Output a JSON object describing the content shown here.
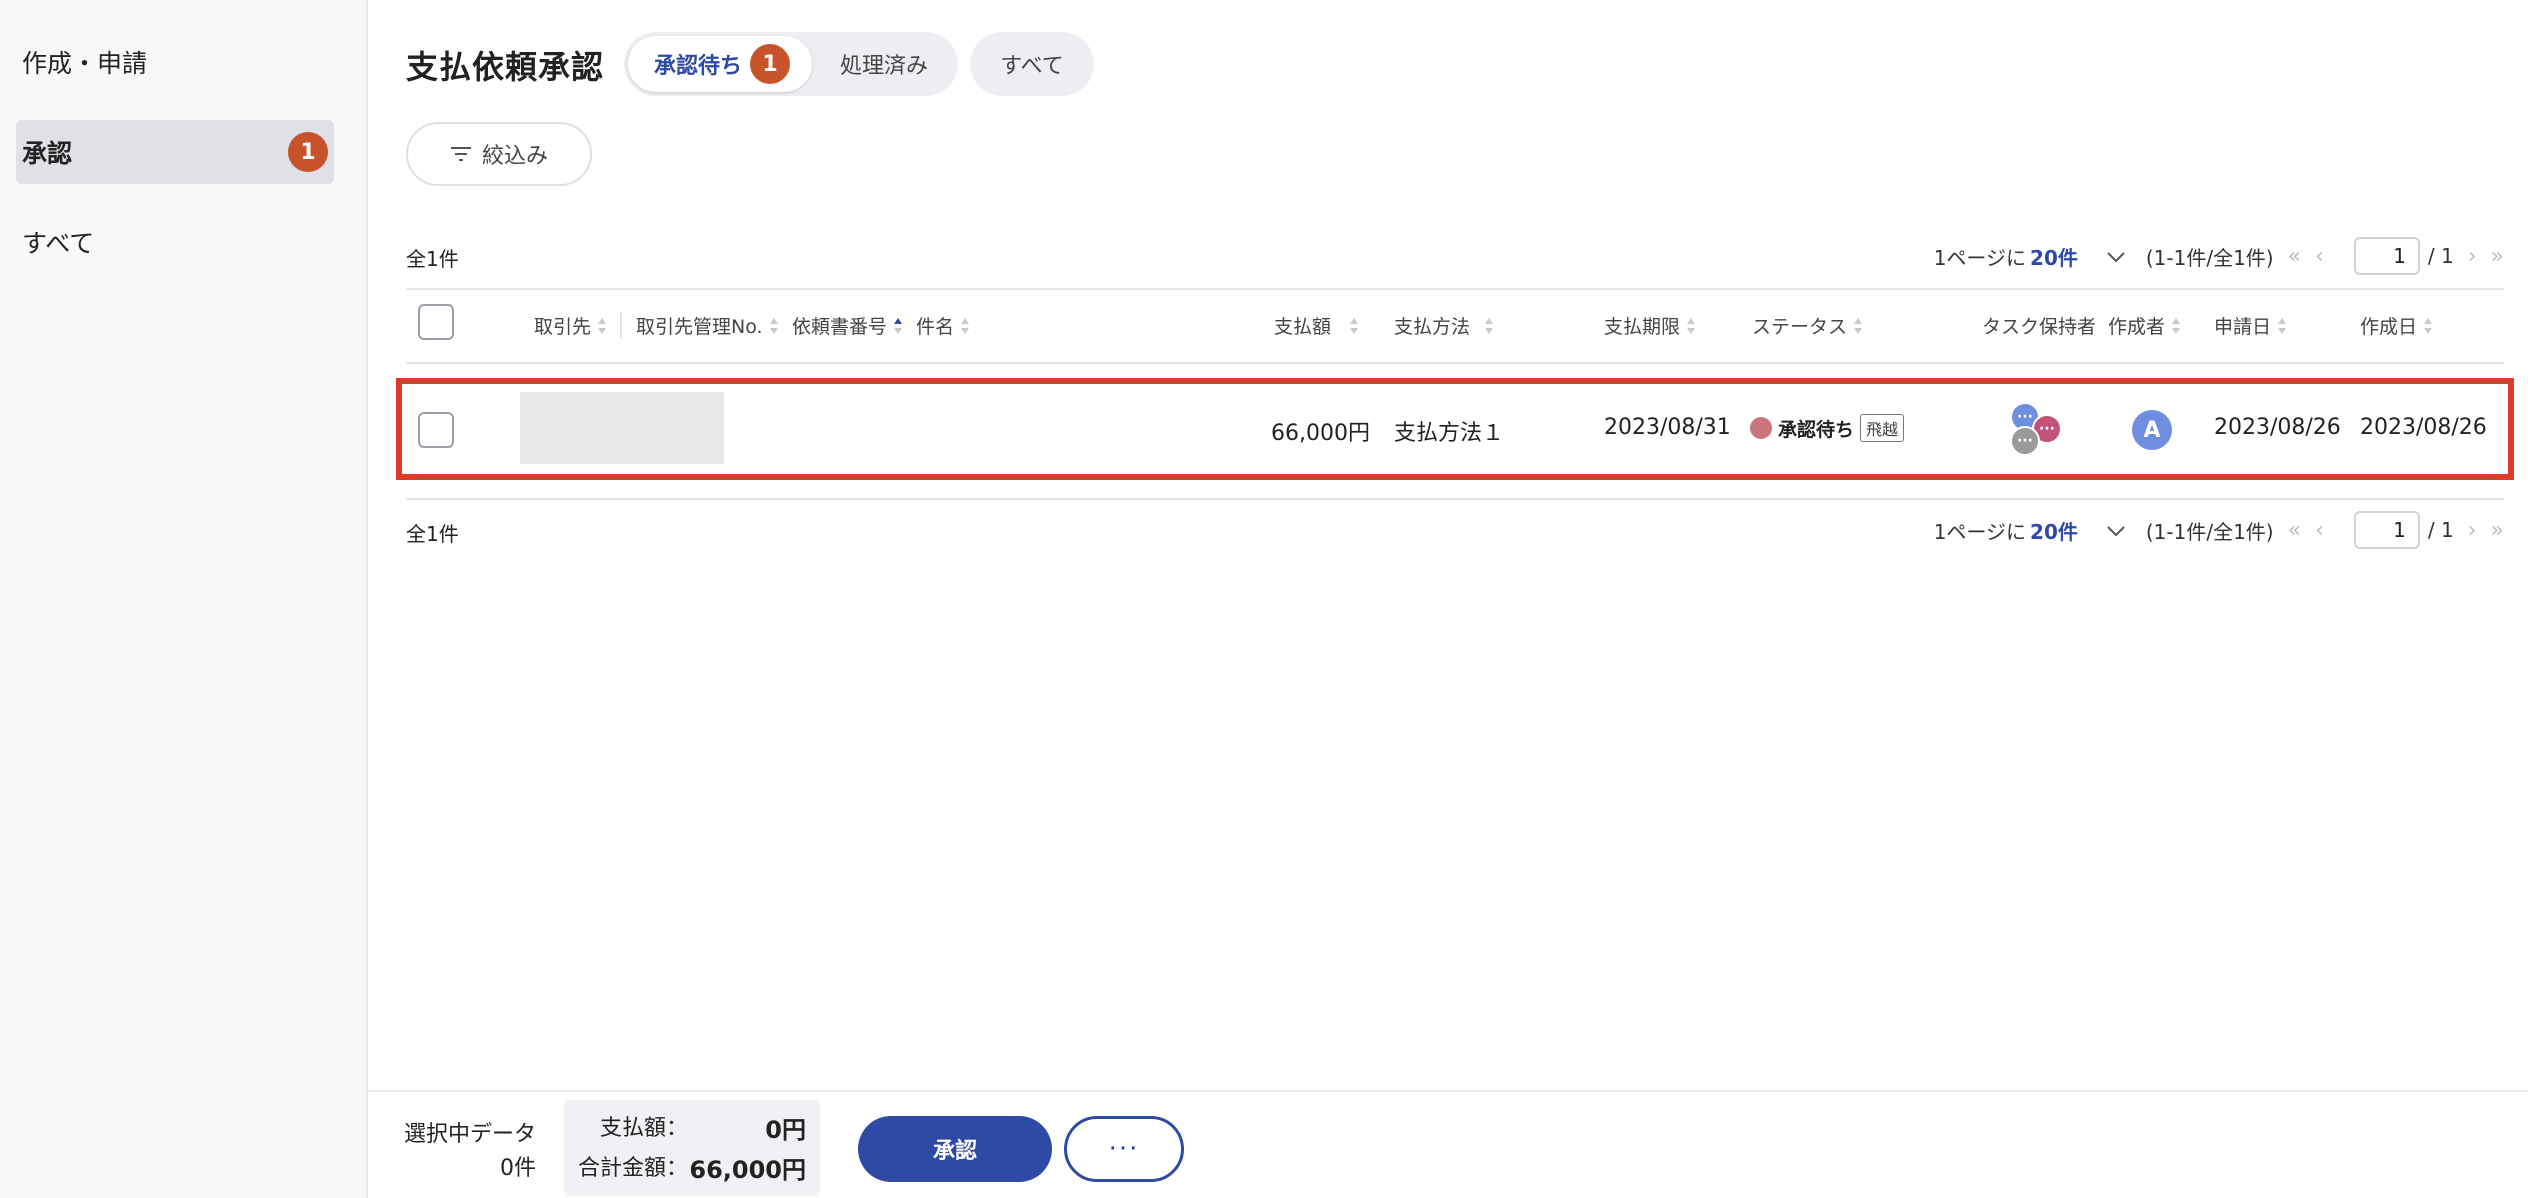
{
  "sidebar": {
    "items": [
      {
        "label": "作成・申請"
      },
      {
        "label": "承認",
        "badge": "1"
      },
      {
        "label": "すべて"
      }
    ]
  },
  "header": {
    "title": "支払依頼承認",
    "tabs": [
      {
        "label": "承認待ち",
        "badge": "1"
      },
      {
        "label": "処理済み"
      }
    ],
    "all_label": "すべて",
    "filter_label": "絞込み"
  },
  "list": {
    "total_label": "全1件",
    "pager": {
      "per_page_prefix": "1ページに",
      "per_page_value": "20件",
      "range": "(1-1件/全1件)",
      "current_page": "1",
      "total_pages": "/ 1"
    },
    "columns": {
      "partner": "取引先",
      "partner_no": "取引先管理No.",
      "request_no": "依頼書番号",
      "subject": "件名",
      "amount": "支払額",
      "method": "支払方法",
      "due": "支払期限",
      "status": "ステータス",
      "holder": "タスク保持者",
      "creator": "作成者",
      "apply_date": "申請日",
      "created_date": "作成日"
    },
    "rows": [
      {
        "amount": "66,000円",
        "method": "支払方法１",
        "due": "2023/08/31",
        "status": "承認待ち",
        "status_tag": "飛越",
        "creator_initial": "A",
        "apply_date": "2023/08/26",
        "created_date": "2023/08/26"
      }
    ]
  },
  "footer": {
    "selected_label": "選択中データ",
    "selected_count": "0件",
    "pay_amount_label": "支払額：",
    "pay_amount_value": "0円",
    "total_label": "合計金額：",
    "total_value": "66,000円",
    "approve_label": "承認",
    "more_label": "···"
  },
  "colors": {
    "accent": "#2f4aa5",
    "badge": "#c8522a",
    "highlight": "#e03a2a",
    "status_dot": "#c9757b"
  }
}
